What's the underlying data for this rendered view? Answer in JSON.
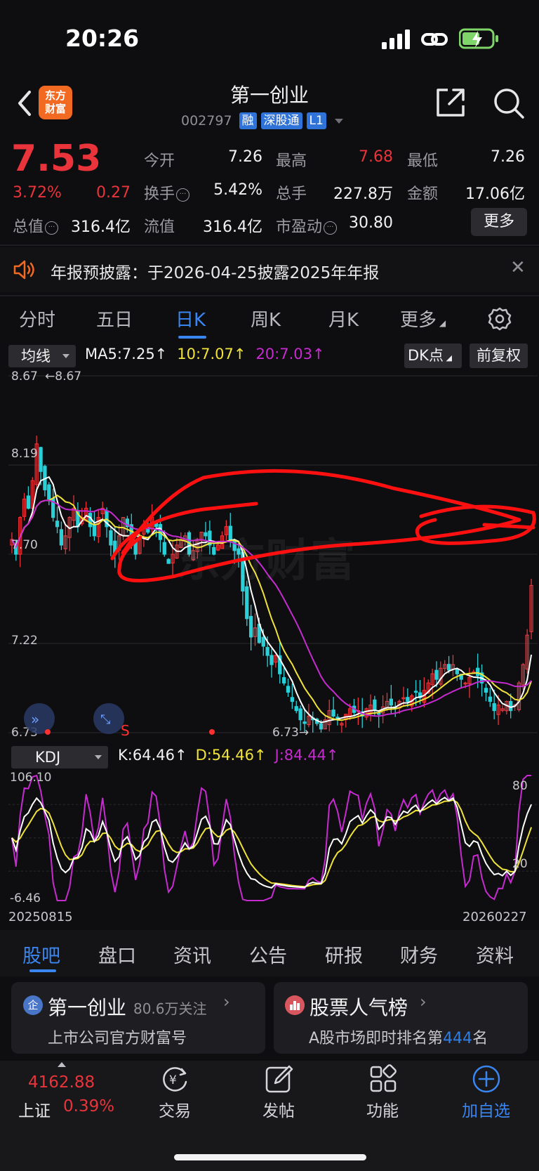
{
  "status_bar": {
    "time": "20:26"
  },
  "header": {
    "logo_line1": "东方",
    "logo_line2": "财富",
    "title": "第一创业",
    "code": "002797",
    "tags": [
      "融",
      "深股通",
      "L1"
    ]
  },
  "quote": {
    "price": "7.53",
    "change_pct": "3.72%",
    "change": "0.27",
    "fields": [
      {
        "label": "今开",
        "value": "7.26"
      },
      {
        "label": "最高",
        "value": "7.68"
      },
      {
        "label": "最低",
        "value": "7.26"
      },
      {
        "label": "换手",
        "value": "5.42%"
      },
      {
        "label": "总手",
        "value": "227.8万"
      },
      {
        "label": "金额",
        "value": "17.06亿"
      },
      {
        "label": "总值",
        "value": "316.4亿"
      },
      {
        "label": "流值",
        "value": "316.4亿"
      },
      {
        "label": "市盈动",
        "value": "30.80"
      }
    ],
    "more_label": "更多"
  },
  "announcement": {
    "text": "年报预披露：于2026-04-25披露2025年年报"
  },
  "period_tabs": [
    "分时",
    "五日",
    "日K",
    "周K",
    "月K",
    "更多"
  ],
  "active_period": "日K",
  "ma_bar": {
    "select_label": "均线",
    "ma5": "MA5:7.25↑",
    "ma10": "10:7.07↑",
    "ma20": "20:7.03↑",
    "dk_label": "DK点",
    "adjust_label": "前复权"
  },
  "colors": {
    "up": "#e8343a",
    "down": "#2ad0d8",
    "ma5": "#ffffff",
    "ma10": "#f0e33a",
    "ma20": "#c62bd0",
    "accent": "#3a86f0"
  },
  "chart_data": {
    "type": "candlestick",
    "price_axis_labels": [
      "8.67",
      "8.19",
      "7.70",
      "7.22",
      "6.73"
    ],
    "ylim": [
      6.73,
      8.67
    ],
    "high_marker": "8.67",
    "low_marker": "6.73",
    "x_start": "20250815",
    "x_end": "20260227",
    "close_series": [
      7.78,
      7.7,
      7.9,
      8.0,
      7.95,
      8.1,
      8.3,
      8.15,
      8.05,
      8.0,
      7.9,
      7.85,
      7.75,
      7.8,
      7.9,
      7.95,
      7.85,
      7.9,
      7.95,
      7.85,
      7.8,
      7.9,
      7.95,
      7.85,
      7.75,
      7.7,
      7.8,
      7.9,
      7.85,
      7.75,
      7.7,
      7.78,
      7.85,
      7.82,
      7.9,
      7.85,
      7.78,
      7.7,
      7.65,
      7.7,
      7.75,
      7.78,
      7.8,
      7.7,
      7.72,
      7.78,
      7.82,
      7.8,
      7.75,
      7.7,
      7.75,
      7.8,
      7.85,
      7.78,
      7.72,
      7.7,
      7.5,
      7.35,
      7.25,
      7.3,
      7.22,
      7.2,
      7.15,
      7.1,
      7.15,
      7.05,
      7.0,
      6.95,
      6.9,
      6.85,
      6.8,
      6.78,
      6.82,
      6.8,
      6.78,
      6.75,
      6.8,
      6.85,
      6.82,
      6.8,
      6.78,
      6.83,
      6.86,
      6.84,
      6.85,
      6.82,
      6.86,
      6.88,
      6.85,
      6.83,
      6.87,
      6.9,
      6.88,
      6.86,
      6.9,
      6.92,
      6.9,
      6.93,
      6.95,
      6.92,
      6.96,
      7.0,
      7.05,
      7.02,
      7.08,
      7.1,
      7.07,
      7.1,
      7.05,
      7.02,
      7.0,
      7.03,
      7.06,
      7.04,
      7.0,
      6.95,
      6.9,
      6.85,
      6.88,
      6.86,
      6.9,
      6.85,
      6.88,
      7.0,
      7.1,
      7.26,
      7.53
    ],
    "kdj": {
      "k_label": "K:64.46↑",
      "d_label": "D:54.46↑",
      "j_label": "J:84.44↑",
      "axis_labels": [
        "106.10",
        "80",
        "20",
        "-6.46"
      ],
      "ylim": [
        -6.46,
        106.1
      ]
    }
  },
  "kdj_select_label": "KDJ",
  "content_tabs": [
    "股吧",
    "盘口",
    "资讯",
    "公告",
    "研报",
    "财务",
    "资料"
  ],
  "active_content_tab": "股吧",
  "cards": [
    {
      "icon_text": "企",
      "title": "第一创业",
      "follow": "80.6万关注",
      "subtitle": "上市公司官方财富号"
    },
    {
      "title": "股票人气榜",
      "subtitle_prefix": "A股市场即时排名第",
      "rank": "444",
      "subtitle_suffix": "名"
    }
  ],
  "bottom_bar": {
    "index_value": "4162.88",
    "index_name": "上证",
    "index_pct": "0.39%",
    "nav": [
      "交易",
      "发帖",
      "功能",
      "加自选"
    ]
  }
}
